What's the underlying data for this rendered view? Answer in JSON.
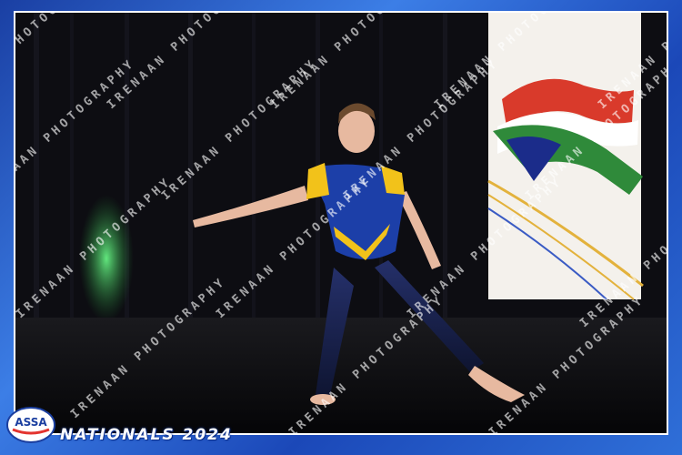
{
  "watermark": {
    "text": "IRENAAN PHOTOGRAPHY"
  },
  "event": {
    "caption": "NATIONALS 2024",
    "logo_text": "ASSA"
  },
  "colors": {
    "frame_blue": "#1f4fb8",
    "costume_blue": "#1c3fa8",
    "costume_yellow": "#f2c21a",
    "banner_red": "#d93a2b",
    "banner_green": "#2f8a3a"
  }
}
